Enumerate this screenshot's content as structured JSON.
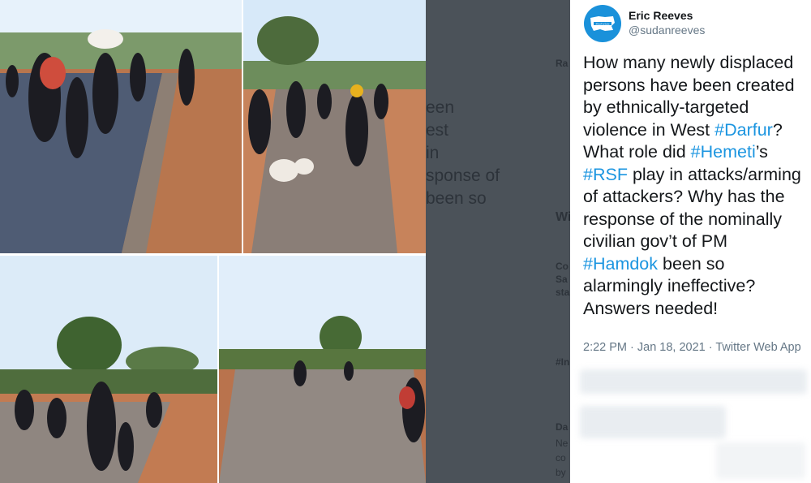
{
  "tweet": {
    "author_name": "Eric Reeves",
    "author_handle": "@sudanreeves",
    "avatar_label": "#NotForSale",
    "lines": [
      [
        {
          "text": "How many newly displaced"
        }
      ],
      [
        {
          "text": "persons have been created"
        }
      ],
      [
        {
          "text": "by ethnically-targeted"
        }
      ],
      [
        {
          "text": "violence in West "
        },
        {
          "text": "#Darfur",
          "tag": true
        },
        {
          "text": "?"
        }
      ],
      [
        {
          "text": "What role did "
        },
        {
          "text": "#Hemeti",
          "tag": true
        },
        {
          "text": "’s"
        }
      ],
      [
        {
          "text": "#RSF",
          "tag": true
        },
        {
          "text": " play in attacks/arming"
        }
      ],
      [
        {
          "text": "of attackers? Why has the"
        }
      ],
      [
        {
          "text": "response of the nominally"
        }
      ],
      [
        {
          "text": "civilian gov’t of PM"
        }
      ],
      [
        {
          "text": "#Hamdok",
          "tag": true
        },
        {
          "text": " been so"
        }
      ],
      [
        {
          "text": "alarmingly ineffective?"
        }
      ],
      [
        {
          "text": "Answers needed!"
        }
      ]
    ],
    "timestamp": "2:22 PM · Jan 18, 2021 · Twitter Web App"
  },
  "background_page": {
    "fragments": [
      "Ra",
      "een",
      "est",
      "in",
      "sponse of",
      "been so",
      "Wi",
      "Co",
      "Sa",
      "sta",
      "#In",
      "Da",
      "Ne",
      "co",
      "by"
    ]
  },
  "colors": {
    "hashtag": "#1b95e0",
    "avatar": "#1a91da",
    "overlay": "#4b5259"
  },
  "photos": [
    {
      "name": "photo-top-left"
    },
    {
      "name": "photo-top-right"
    },
    {
      "name": "photo-bottom-left"
    },
    {
      "name": "photo-bottom-right"
    }
  ]
}
